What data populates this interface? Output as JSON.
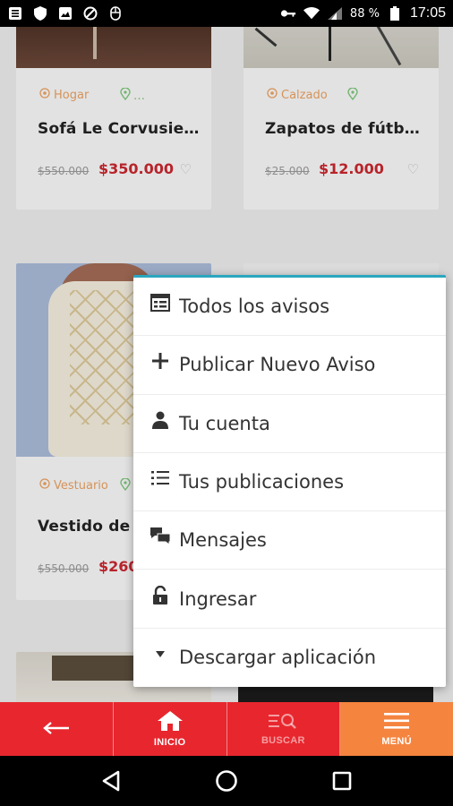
{
  "status_bar": {
    "battery": "88 %",
    "time": "17:05"
  },
  "cards": [
    {
      "category": "Hogar",
      "title": "Sofá Le Corvusie…",
      "old_price": "$550.000",
      "new_price": "$350.000"
    },
    {
      "category": "Calzado",
      "title": "Zapatos de fútb…",
      "old_price": "$25.000",
      "new_price": "$12.000"
    },
    {
      "category": "Vestuario",
      "title": "Vestido de I",
      "old_price": "$550.000",
      "new_price": "$260"
    }
  ],
  "menu": {
    "items": [
      {
        "label": "Todos los avisos",
        "icon": "list-grid-icon"
      },
      {
        "label": "Publicar Nuevo Aviso",
        "icon": "plus-icon"
      },
      {
        "label": "Tu cuenta",
        "icon": "user-icon"
      },
      {
        "label": "Tus publicaciones",
        "icon": "list-icon"
      },
      {
        "label": "Mensajes",
        "icon": "chat-icon"
      },
      {
        "label": "Ingresar",
        "icon": "unlock-icon"
      },
      {
        "label": "Descargar aplicación",
        "icon": "caret-down-icon"
      }
    ]
  },
  "bottom_nav": {
    "inicio": "INICIO",
    "buscar": "BUSCAR",
    "menu": "MENÚ"
  },
  "colors": {
    "brand_red": "#e8262e",
    "accent_orange": "#f5843f",
    "menu_top": "#2aa6c0"
  }
}
